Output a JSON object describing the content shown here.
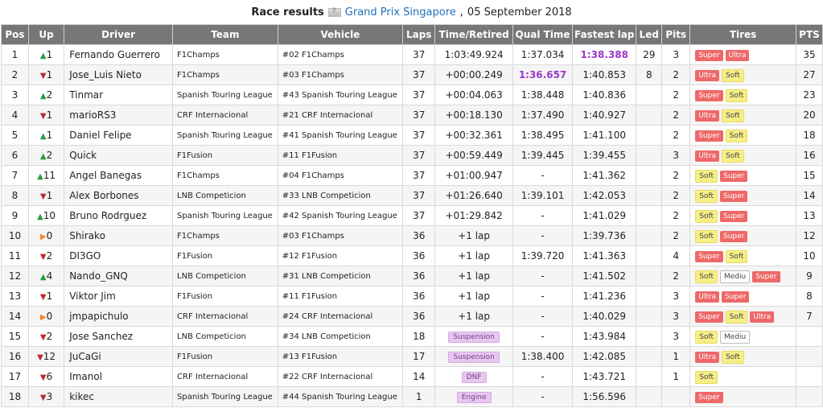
{
  "title": {
    "label": "Race results",
    "track": "Grand Prix Singapore",
    "separator": ",",
    "date": "05 September 2018"
  },
  "columns": [
    "Pos",
    "Up",
    "Driver",
    "Team",
    "Vehicle",
    "Laps",
    "Time/Retired",
    "Qual Time",
    "Fastest lap",
    "Led",
    "Pits",
    "Tires",
    "PTS"
  ],
  "rows": [
    {
      "pos": "1",
      "dir": "up",
      "up": "1",
      "driver": "Fernando Guerrero",
      "team": "F1Champs",
      "vehicle": "#02 F1Champs",
      "laps": "37",
      "time": "1:03:49.924",
      "qual": "1:37.034",
      "fastest": "1:38.388",
      "led": "29",
      "pits": "3",
      "tires": [
        "Super",
        "Ultra"
      ],
      "pts": "35"
    },
    {
      "pos": "2",
      "dir": "down",
      "up": "1",
      "driver": "Jose_Luis Nieto",
      "team": "F1Champs",
      "vehicle": "#03 F1Champs",
      "laps": "37",
      "time": "+00:00.249",
      "qual": "1:36.657",
      "fastest": "1:40.853",
      "led": "8",
      "pits": "2",
      "tires": [
        "Ultra",
        "Soft"
      ],
      "pts": "27"
    },
    {
      "pos": "3",
      "dir": "up",
      "up": "2",
      "driver": "Tinmar",
      "team": "Spanish Touring League",
      "vehicle": "#43 Spanish Touring League",
      "laps": "37",
      "time": "+00:04.063",
      "qual": "1:38.448",
      "fastest": "1:40.836",
      "led": "",
      "pits": "2",
      "tires": [
        "Super",
        "Soft"
      ],
      "pts": "23"
    },
    {
      "pos": "4",
      "dir": "down",
      "up": "1",
      "driver": "marioRS3",
      "team": "CRF Internacional",
      "vehicle": "#21 CRF Internacional",
      "laps": "37",
      "time": "+00:18.130",
      "qual": "1:37.490",
      "fastest": "1:40.927",
      "led": "",
      "pits": "2",
      "tires": [
        "Ultra",
        "Soft"
      ],
      "pts": "20"
    },
    {
      "pos": "5",
      "dir": "up",
      "up": "1",
      "driver": "Daniel Felipe",
      "team": "Spanish Touring League",
      "vehicle": "#41 Spanish Touring League",
      "laps": "37",
      "time": "+00:32.361",
      "qual": "1:38.495",
      "fastest": "1:41.100",
      "led": "",
      "pits": "2",
      "tires": [
        "Super",
        "Soft"
      ],
      "pts": "18"
    },
    {
      "pos": "6",
      "dir": "up",
      "up": "2",
      "driver": "Quick",
      "team": "F1Fusion",
      "vehicle": "#11 F1Fusion",
      "laps": "37",
      "time": "+00:59.449",
      "qual": "1:39.445",
      "fastest": "1:39.455",
      "led": "",
      "pits": "3",
      "tires": [
        "Ultra",
        "Soft"
      ],
      "pts": "16"
    },
    {
      "pos": "7",
      "dir": "up",
      "up": "11",
      "driver": "Angel Banegas",
      "team": "F1Champs",
      "vehicle": "#04 F1Champs",
      "laps": "37",
      "time": "+01:00.947",
      "qual": "-",
      "fastest": "1:41.362",
      "led": "",
      "pits": "2",
      "tires": [
        "Soft",
        "Super"
      ],
      "pts": "15"
    },
    {
      "pos": "8",
      "dir": "down",
      "up": "1",
      "driver": "Alex Borbones",
      "team": "LNB Competicion",
      "vehicle": "#33 LNB Competicion",
      "laps": "37",
      "time": "+01:26.640",
      "qual": "1:39.101",
      "fastest": "1:42.053",
      "led": "",
      "pits": "2",
      "tires": [
        "Soft",
        "Super"
      ],
      "pts": "14"
    },
    {
      "pos": "9",
      "dir": "up",
      "up": "10",
      "driver": "Bruno Rodrguez",
      "team": "Spanish Touring League",
      "vehicle": "#42 Spanish Touring League",
      "laps": "37",
      "time": "+01:29.842",
      "qual": "-",
      "fastest": "1:41.029",
      "led": "",
      "pits": "2",
      "tires": [
        "Soft",
        "Super"
      ],
      "pts": "13"
    },
    {
      "pos": "10",
      "dir": "same",
      "up": "0",
      "driver": "Shirako",
      "team": "F1Champs",
      "vehicle": "#03 F1Champs",
      "laps": "36",
      "time": "+1 lap",
      "qual": "-",
      "fastest": "1:39.736",
      "led": "",
      "pits": "2",
      "tires": [
        "Soft",
        "Super"
      ],
      "pts": "12"
    },
    {
      "pos": "11",
      "dir": "down",
      "up": "2",
      "driver": "DI3GO",
      "team": "F1Fusion",
      "vehicle": "#12 F1Fusion",
      "laps": "36",
      "time": "+1 lap",
      "qual": "1:39.720",
      "fastest": "1:41.363",
      "led": "",
      "pits": "4",
      "tires": [
        "Super",
        "Soft"
      ],
      "pts": "10"
    },
    {
      "pos": "12",
      "dir": "up",
      "up": "4",
      "driver": "Nando_GNQ",
      "team": "LNB Competicion",
      "vehicle": "#31 LNB Competicion",
      "laps": "36",
      "time": "+1 lap",
      "qual": "-",
      "fastest": "1:41.502",
      "led": "",
      "pits": "2",
      "tires": [
        "Soft",
        "Mediu",
        "Super"
      ],
      "pts": "9"
    },
    {
      "pos": "13",
      "dir": "down",
      "up": "1",
      "driver": "Viktor Jim",
      "team": "F1Fusion",
      "vehicle": "#11 F1Fusion",
      "laps": "36",
      "time": "+1 lap",
      "qual": "-",
      "fastest": "1:41.236",
      "led": "",
      "pits": "3",
      "tires": [
        "Ultra",
        "Super"
      ],
      "pts": "8"
    },
    {
      "pos": "14",
      "dir": "same",
      "up": "0",
      "driver": "jmpapichulo",
      "team": "CRF Internacional",
      "vehicle": "#24 CRF Internacional",
      "laps": "36",
      "time": "+1 lap",
      "qual": "-",
      "fastest": "1:40.029",
      "led": "",
      "pits": "3",
      "tires": [
        "Super",
        "Soft",
        "Ultra"
      ],
      "pts": "7"
    },
    {
      "pos": "15",
      "dir": "down",
      "up": "2",
      "driver": "Jose Sanchez",
      "team": "LNB Competicion",
      "vehicle": "#34 LNB Competicion",
      "laps": "18",
      "time": "Suspension",
      "time_tag": true,
      "qual": "-",
      "fastest": "1:43.984",
      "led": "",
      "pits": "3",
      "tires": [
        "Soft",
        "Mediu"
      ],
      "pts": ""
    },
    {
      "pos": "16",
      "dir": "down",
      "up": "12",
      "driver": "JuCaGi",
      "team": "F1Fusion",
      "vehicle": "#13 F1Fusion",
      "laps": "17",
      "time": "Suspension",
      "time_tag": true,
      "qual": "1:38.400",
      "fastest": "1:42.085",
      "led": "",
      "pits": "1",
      "tires": [
        "Ultra",
        "Soft"
      ],
      "pts": ""
    },
    {
      "pos": "17",
      "dir": "down",
      "up": "6",
      "driver": "Imanol",
      "team": "CRF Internacional",
      "vehicle": "#22 CRF Internacional",
      "laps": "14",
      "time": "DNF",
      "time_tag": true,
      "qual": "-",
      "fastest": "1:43.721",
      "led": "",
      "pits": "1",
      "tires": [
        "Soft"
      ],
      "pts": ""
    },
    {
      "pos": "18",
      "dir": "down",
      "up": "3",
      "driver": "kikec",
      "team": "Spanish Touring League",
      "vehicle": "#44 Spanish Touring League",
      "laps": "1",
      "time": "Engine",
      "time_tag": true,
      "qual": "-",
      "fastest": "1:56.596",
      "led": "",
      "pits": "",
      "tires": [
        "Super"
      ],
      "pts": ""
    }
  ],
  "highlights": {
    "fastest_lap_row": 0,
    "best_qual_row": 1
  },
  "colors": {
    "header_bg": "#777777",
    "up": "#2a9d3a",
    "down": "#c0282d",
    "same": "#f08a24",
    "purple": "#9b35c9",
    "super_ultra": "#ee6868",
    "soft": "#f6ef88",
    "status_tag": "#e6c8ee"
  },
  "icons": {
    "up": "triangle-up-icon",
    "down": "triangle-down-icon",
    "same": "triangle-right-icon"
  }
}
